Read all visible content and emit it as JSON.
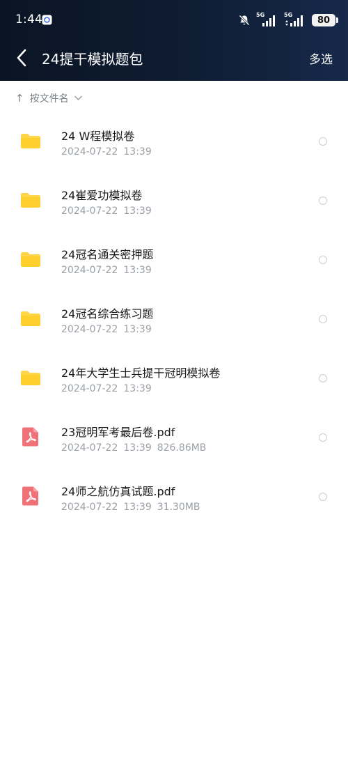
{
  "status_bar": {
    "time": "1:44",
    "network1": "5G",
    "network2": "5G",
    "battery": "80"
  },
  "nav": {
    "title": "24提干模拟题包",
    "multiselect_label": "多选"
  },
  "sort": {
    "arrow": "↑",
    "label": "按文件名",
    "chevron": "⌄"
  },
  "files": [
    {
      "type": "folder",
      "name": "24 W程模拟卷",
      "date": "2024-07-22",
      "time": "13:39",
      "size": ""
    },
    {
      "type": "folder",
      "name": "24崔爱功模拟卷",
      "date": "2024-07-22",
      "time": "13:39",
      "size": ""
    },
    {
      "type": "folder",
      "name": "24冠名通关密押题",
      "date": "2024-07-22",
      "time": "13:39",
      "size": ""
    },
    {
      "type": "folder",
      "name": "24冠名综合练习题",
      "date": "2024-07-22",
      "time": "13:39",
      "size": ""
    },
    {
      "type": "folder",
      "name": "24年大学生士兵提干冠明模拟卷",
      "date": "2024-07-22",
      "time": "13:39",
      "size": ""
    },
    {
      "type": "pdf",
      "name": "23冠明军考最后卷.pdf",
      "date": "2024-07-22",
      "time": "13:39",
      "size": "826.86MB"
    },
    {
      "type": "pdf",
      "name": "24师之航仿真试题.pdf",
      "date": "2024-07-22",
      "time": "13:39",
      "size": "31.30MB"
    }
  ],
  "colors": {
    "folder": "#ffd64a",
    "pdf": "#f07178",
    "header_bg": "#0f1d33"
  }
}
